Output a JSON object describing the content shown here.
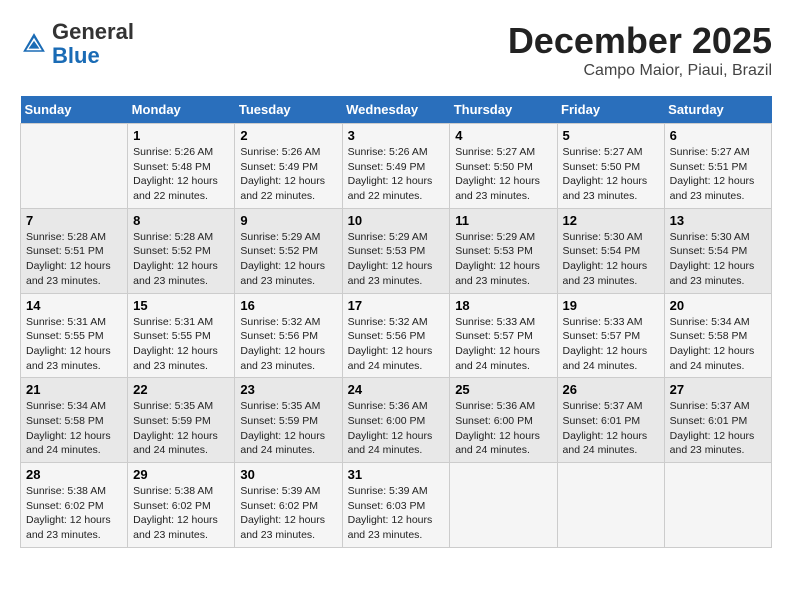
{
  "header": {
    "logo_general": "General",
    "logo_blue": "Blue",
    "month": "December 2025",
    "location": "Campo Maior, Piaui, Brazil"
  },
  "days_of_week": [
    "Sunday",
    "Monday",
    "Tuesday",
    "Wednesday",
    "Thursday",
    "Friday",
    "Saturday"
  ],
  "weeks": [
    [
      {
        "day": "",
        "info": ""
      },
      {
        "day": "1",
        "info": "Sunrise: 5:26 AM\nSunset: 5:48 PM\nDaylight: 12 hours\nand 22 minutes."
      },
      {
        "day": "2",
        "info": "Sunrise: 5:26 AM\nSunset: 5:49 PM\nDaylight: 12 hours\nand 22 minutes."
      },
      {
        "day": "3",
        "info": "Sunrise: 5:26 AM\nSunset: 5:49 PM\nDaylight: 12 hours\nand 22 minutes."
      },
      {
        "day": "4",
        "info": "Sunrise: 5:27 AM\nSunset: 5:50 PM\nDaylight: 12 hours\nand 23 minutes."
      },
      {
        "day": "5",
        "info": "Sunrise: 5:27 AM\nSunset: 5:50 PM\nDaylight: 12 hours\nand 23 minutes."
      },
      {
        "day": "6",
        "info": "Sunrise: 5:27 AM\nSunset: 5:51 PM\nDaylight: 12 hours\nand 23 minutes."
      }
    ],
    [
      {
        "day": "7",
        "info": "Sunrise: 5:28 AM\nSunset: 5:51 PM\nDaylight: 12 hours\nand 23 minutes."
      },
      {
        "day": "8",
        "info": "Sunrise: 5:28 AM\nSunset: 5:52 PM\nDaylight: 12 hours\nand 23 minutes."
      },
      {
        "day": "9",
        "info": "Sunrise: 5:29 AM\nSunset: 5:52 PM\nDaylight: 12 hours\nand 23 minutes."
      },
      {
        "day": "10",
        "info": "Sunrise: 5:29 AM\nSunset: 5:53 PM\nDaylight: 12 hours\nand 23 minutes."
      },
      {
        "day": "11",
        "info": "Sunrise: 5:29 AM\nSunset: 5:53 PM\nDaylight: 12 hours\nand 23 minutes."
      },
      {
        "day": "12",
        "info": "Sunrise: 5:30 AM\nSunset: 5:54 PM\nDaylight: 12 hours\nand 23 minutes."
      },
      {
        "day": "13",
        "info": "Sunrise: 5:30 AM\nSunset: 5:54 PM\nDaylight: 12 hours\nand 23 minutes."
      }
    ],
    [
      {
        "day": "14",
        "info": "Sunrise: 5:31 AM\nSunset: 5:55 PM\nDaylight: 12 hours\nand 23 minutes."
      },
      {
        "day": "15",
        "info": "Sunrise: 5:31 AM\nSunset: 5:55 PM\nDaylight: 12 hours\nand 23 minutes."
      },
      {
        "day": "16",
        "info": "Sunrise: 5:32 AM\nSunset: 5:56 PM\nDaylight: 12 hours\nand 23 minutes."
      },
      {
        "day": "17",
        "info": "Sunrise: 5:32 AM\nSunset: 5:56 PM\nDaylight: 12 hours\nand 24 minutes."
      },
      {
        "day": "18",
        "info": "Sunrise: 5:33 AM\nSunset: 5:57 PM\nDaylight: 12 hours\nand 24 minutes."
      },
      {
        "day": "19",
        "info": "Sunrise: 5:33 AM\nSunset: 5:57 PM\nDaylight: 12 hours\nand 24 minutes."
      },
      {
        "day": "20",
        "info": "Sunrise: 5:34 AM\nSunset: 5:58 PM\nDaylight: 12 hours\nand 24 minutes."
      }
    ],
    [
      {
        "day": "21",
        "info": "Sunrise: 5:34 AM\nSunset: 5:58 PM\nDaylight: 12 hours\nand 24 minutes."
      },
      {
        "day": "22",
        "info": "Sunrise: 5:35 AM\nSunset: 5:59 PM\nDaylight: 12 hours\nand 24 minutes."
      },
      {
        "day": "23",
        "info": "Sunrise: 5:35 AM\nSunset: 5:59 PM\nDaylight: 12 hours\nand 24 minutes."
      },
      {
        "day": "24",
        "info": "Sunrise: 5:36 AM\nSunset: 6:00 PM\nDaylight: 12 hours\nand 24 minutes."
      },
      {
        "day": "25",
        "info": "Sunrise: 5:36 AM\nSunset: 6:00 PM\nDaylight: 12 hours\nand 24 minutes."
      },
      {
        "day": "26",
        "info": "Sunrise: 5:37 AM\nSunset: 6:01 PM\nDaylight: 12 hours\nand 24 minutes."
      },
      {
        "day": "27",
        "info": "Sunrise: 5:37 AM\nSunset: 6:01 PM\nDaylight: 12 hours\nand 23 minutes."
      }
    ],
    [
      {
        "day": "28",
        "info": "Sunrise: 5:38 AM\nSunset: 6:02 PM\nDaylight: 12 hours\nand 23 minutes."
      },
      {
        "day": "29",
        "info": "Sunrise: 5:38 AM\nSunset: 6:02 PM\nDaylight: 12 hours\nand 23 minutes."
      },
      {
        "day": "30",
        "info": "Sunrise: 5:39 AM\nSunset: 6:02 PM\nDaylight: 12 hours\nand 23 minutes."
      },
      {
        "day": "31",
        "info": "Sunrise: 5:39 AM\nSunset: 6:03 PM\nDaylight: 12 hours\nand 23 minutes."
      },
      {
        "day": "",
        "info": ""
      },
      {
        "day": "",
        "info": ""
      },
      {
        "day": "",
        "info": ""
      }
    ]
  ]
}
